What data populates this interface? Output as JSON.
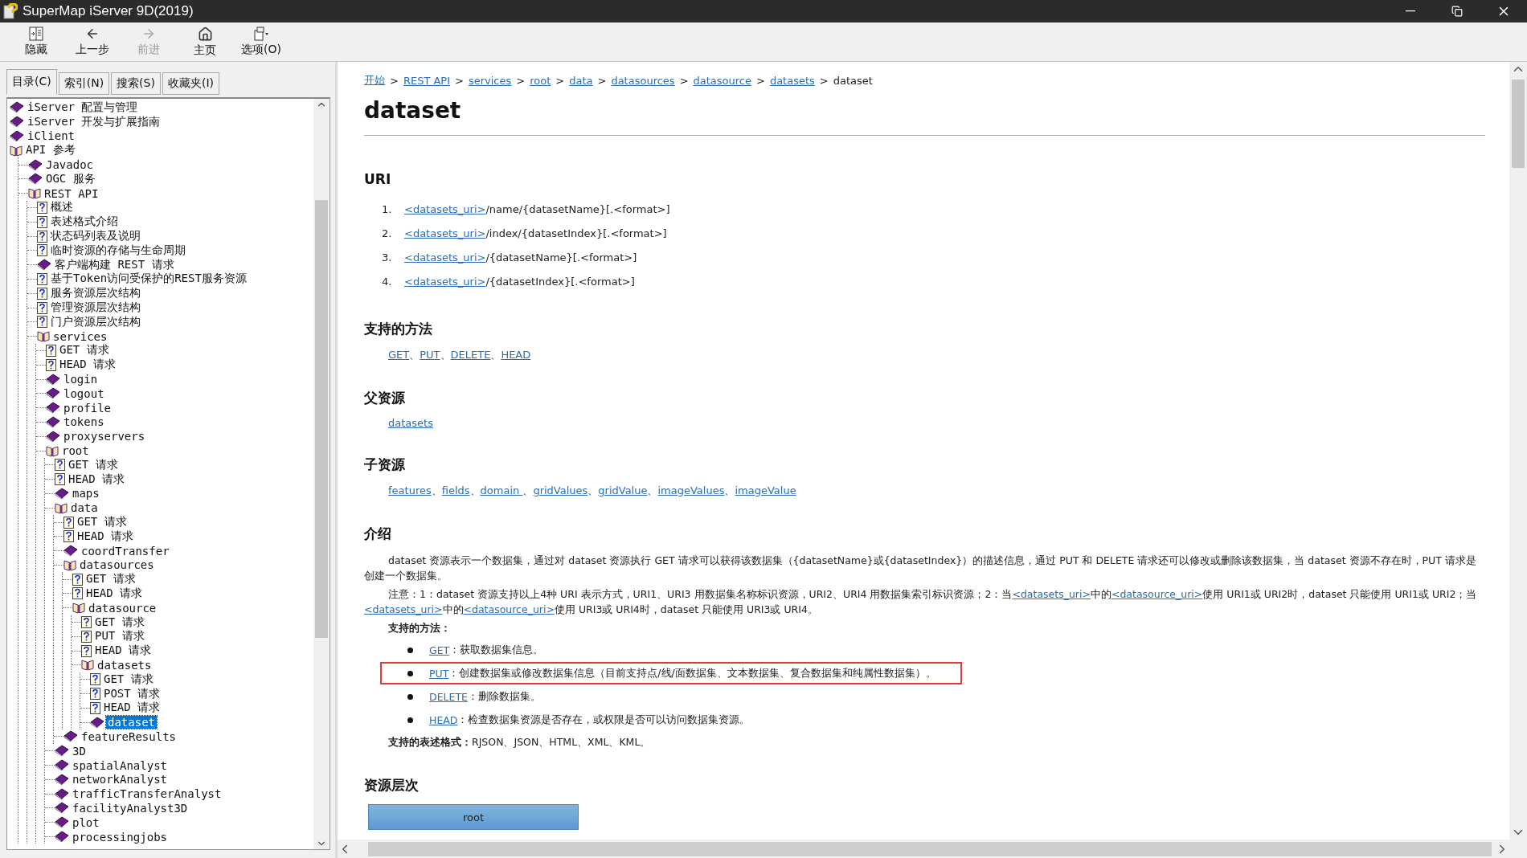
{
  "window": {
    "title": "SuperMap iServer 9D(2019)"
  },
  "toolbar": [
    {
      "label": "隐藏",
      "kind": "hide",
      "disabled": false
    },
    {
      "label": "上一步",
      "kind": "back",
      "disabled": false
    },
    {
      "label": "前进",
      "kind": "forward",
      "disabled": true
    },
    {
      "label": "主页",
      "kind": "home",
      "disabled": false
    },
    {
      "label": "选项(O)",
      "kind": "options",
      "disabled": false
    }
  ],
  "tabs": [
    {
      "label": "目录(C)",
      "selected": true
    },
    {
      "label": "索引(N)",
      "selected": false
    },
    {
      "label": "搜索(S)",
      "selected": false
    },
    {
      "label": "收藏夹(I)",
      "selected": false
    }
  ],
  "tree": [
    {
      "label": "iServer 配置与管理",
      "kind": "book",
      "selected": false
    },
    {
      "label": "iServer 开发与扩展指南",
      "kind": "book",
      "selected": false
    },
    {
      "label": "iClient",
      "kind": "book",
      "selected": false
    },
    {
      "label": "API 参考",
      "kind": "book",
      "expanded": true,
      "selected": false,
      "children": [
        {
          "label": "Javadoc",
          "kind": "book",
          "selected": false
        },
        {
          "label": "OGC 服务",
          "kind": "book",
          "selected": false
        },
        {
          "label": "REST API",
          "kind": "book",
          "expanded": true,
          "selected": false,
          "children": [
            {
              "label": "概述",
              "kind": "page",
              "selected": false
            },
            {
              "label": "表述格式介绍",
              "kind": "page",
              "selected": false
            },
            {
              "label": "状态码列表及说明",
              "kind": "page",
              "selected": false
            },
            {
              "label": "临时资源的存储与生命周期",
              "kind": "page",
              "selected": false
            },
            {
              "label": "客户端构建 REST 请求",
              "kind": "book",
              "selected": false
            },
            {
              "label": "基于Token访问受保护的REST服务资源",
              "kind": "page",
              "selected": false
            },
            {
              "label": "服务资源层次结构",
              "kind": "page",
              "selected": false
            },
            {
              "label": "管理资源层次结构",
              "kind": "page",
              "selected": false
            },
            {
              "label": "门户资源层次结构",
              "kind": "page",
              "selected": false
            },
            {
              "label": "services",
              "kind": "book",
              "expanded": true,
              "selected": false,
              "children": [
                {
                  "label": "GET 请求",
                  "kind": "page",
                  "selected": false
                },
                {
                  "label": "HEAD 请求",
                  "kind": "page",
                  "selected": false
                },
                {
                  "label": "login",
                  "kind": "book",
                  "selected": false
                },
                {
                  "label": "logout",
                  "kind": "book",
                  "selected": false
                },
                {
                  "label": "profile",
                  "kind": "book",
                  "selected": false
                },
                {
                  "label": "tokens",
                  "kind": "book",
                  "selected": false
                },
                {
                  "label": "proxyservers",
                  "kind": "book",
                  "selected": false
                },
                {
                  "label": "root",
                  "kind": "book",
                  "expanded": true,
                  "selected": false,
                  "children": [
                    {
                      "label": "GET 请求",
                      "kind": "page",
                      "selected": false
                    },
                    {
                      "label": "HEAD 请求",
                      "kind": "page",
                      "selected": false
                    },
                    {
                      "label": "maps",
                      "kind": "book",
                      "selected": false
                    },
                    {
                      "label": "data",
                      "kind": "book",
                      "expanded": true,
                      "selected": false,
                      "children": [
                        {
                          "label": "GET 请求",
                          "kind": "page",
                          "selected": false
                        },
                        {
                          "label": "HEAD 请求",
                          "kind": "page",
                          "selected": false
                        },
                        {
                          "label": "coordTransfer",
                          "kind": "book",
                          "selected": false
                        },
                        {
                          "label": "datasources",
                          "kind": "book",
                          "expanded": true,
                          "selected": false,
                          "children": [
                            {
                              "label": "GET 请求",
                              "kind": "page",
                              "selected": false
                            },
                            {
                              "label": "HEAD 请求",
                              "kind": "page",
                              "selected": false
                            },
                            {
                              "label": "datasource",
                              "kind": "book",
                              "expanded": true,
                              "selected": false,
                              "children": [
                                {
                                  "label": "GET 请求",
                                  "kind": "page",
                                  "selected": false
                                },
                                {
                                  "label": "PUT 请求",
                                  "kind": "page",
                                  "selected": false
                                },
                                {
                                  "label": "HEAD 请求",
                                  "kind": "page",
                                  "selected": false
                                },
                                {
                                  "label": "datasets",
                                  "kind": "book",
                                  "expanded": true,
                                  "selected": false,
                                  "children": [
                                    {
                                      "label": "GET 请求",
                                      "kind": "page",
                                      "selected": false
                                    },
                                    {
                                      "label": "POST 请求",
                                      "kind": "page",
                                      "selected": false
                                    },
                                    {
                                      "label": "HEAD 请求",
                                      "kind": "page",
                                      "selected": false
                                    },
                                    {
                                      "label": "dataset",
                                      "kind": "book",
                                      "selected": true
                                    }
                                  ]
                                }
                              ]
                            }
                          ]
                        },
                        {
                          "label": "featureResults",
                          "kind": "book",
                          "selected": false
                        }
                      ]
                    },
                    {
                      "label": "3D",
                      "kind": "book",
                      "selected": false
                    },
                    {
                      "label": "spatialAnalyst",
                      "kind": "book",
                      "selected": false
                    },
                    {
                      "label": "networkAnalyst",
                      "kind": "book",
                      "selected": false
                    },
                    {
                      "label": "trafficTransferAnalyst",
                      "kind": "book",
                      "selected": false
                    },
                    {
                      "label": "facilityAnalyst3D",
                      "kind": "book",
                      "selected": false
                    },
                    {
                      "label": "plot",
                      "kind": "book",
                      "selected": false
                    },
                    {
                      "label": "processingjobs",
                      "kind": "book",
                      "selected": false
                    }
                  ]
                }
              ]
            }
          ]
        }
      ]
    }
  ],
  "breadcrumb": {
    "separator": ">",
    "items": [
      {
        "label": "开始",
        "link": true
      },
      {
        "label": "REST API",
        "link": true
      },
      {
        "label": "services",
        "link": true
      },
      {
        "label": "root",
        "link": true
      },
      {
        "label": "data",
        "link": true
      },
      {
        "label": "datasources",
        "link": true
      },
      {
        "label": "datasource",
        "link": true
      },
      {
        "label": "datasets",
        "link": true
      },
      {
        "label": "dataset",
        "link": false
      }
    ]
  },
  "heading": "dataset",
  "uri": {
    "title": "URI",
    "items": [
      {
        "number": "1.",
        "link": "<datasets_uri>",
        "rest": "/name/{datasetName}[.<format>]"
      },
      {
        "number": "2.",
        "link": "<datasets_uri>",
        "rest": "/index/{datasetIndex}[.<format>]"
      },
      {
        "number": "3.",
        "link": "<datasets_uri>",
        "rest": "/{datasetName}[.<format>]"
      },
      {
        "number": "4.",
        "link": "<datasets_uri>",
        "rest": "/{datasetIndex}[.<format>]"
      }
    ]
  },
  "methods": {
    "title": "支持的方法",
    "separator": "、",
    "links": [
      "GET",
      "PUT",
      "DELETE",
      "HEAD"
    ]
  },
  "parent": {
    "title": "父资源",
    "links": [
      "datasets"
    ]
  },
  "children_resources": {
    "title": "子资源",
    "separator": "、",
    "links": [
      "features",
      "fields",
      "domain ",
      "gridValues",
      "gridValue",
      "imageValues",
      "imageValue"
    ]
  },
  "intro": {
    "title": "介绍",
    "paragraphs": [
      [
        {
          "kind": "text",
          "text": "dataset 资源表示一个数据集，通过对 dataset 资源执行 GET 请求可以获得该数据集（{datasetName}或{datasetIndex}）的描述信息，通过 PUT 和 DELETE 请求还可以修改或删除该数据集，当 dataset 资源不存在时，PUT 请求是创建一个数据集。"
        }
      ],
      [
        {
          "kind": "text",
          "text": "注意：1：dataset 资源支持以上4种 URI 表示方式，URI1、URI3 用数据集名称标识资源，URI2、URI4 用数据集索引标识资源；2：当"
        },
        {
          "kind": "link",
          "text": "<datasets_uri>"
        },
        {
          "kind": "text",
          "text": "中的"
        },
        {
          "kind": "link",
          "text": "<datasource_uri>"
        },
        {
          "kind": "text",
          "text": "使用 URI1或 URI2时，dataset 只能使用 URI1或 URI2；当"
        },
        {
          "kind": "link",
          "text": "<datasets_uri>"
        },
        {
          "kind": "text",
          "text": "中的"
        },
        {
          "kind": "link",
          "text": "<datasource_uri>"
        },
        {
          "kind": "text",
          "text": "使用 URI3或 URI4时，dataset 只能使用 URI3或 URI4。"
        }
      ]
    ],
    "methods_label": "支持的方法：",
    "methods": [
      {
        "method": "GET",
        "text": "：获取数据集信息。",
        "highlighted": false
      },
      {
        "method": "PUT",
        "text": "：创建数据集或修改数据集信息（目前支持点/线/面数据集、文本数据集、复合数据集和纯属性数据集）。",
        "highlighted": true
      },
      {
        "method": "DELETE",
        "text": "：删除数据集。",
        "highlighted": false
      },
      {
        "method": "HEAD",
        "text": "：检查数据集资源是否存在，或权限是否可以访问数据集资源。",
        "highlighted": false
      }
    ],
    "formats": "**支持的表述格式：**RJSON、JSON、HTML、XML、KML。"
  },
  "hierarchy": {
    "title": "资源层次",
    "nodes": [
      "root"
    ]
  }
}
